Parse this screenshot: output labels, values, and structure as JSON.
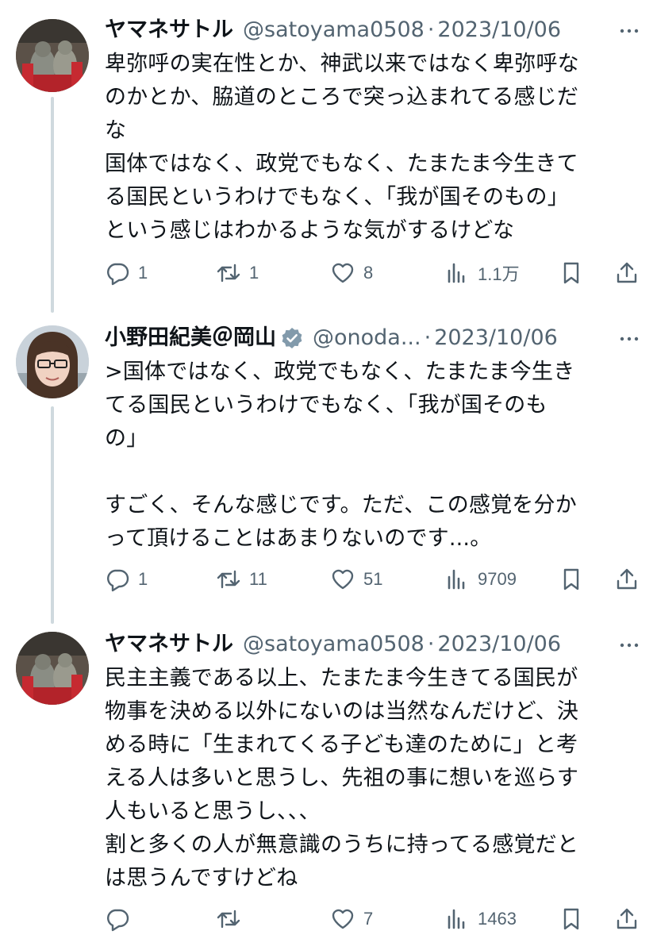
{
  "tweets": [
    {
      "author": "ヤマネサトル",
      "handle": "@satoyama0508",
      "separator": "·",
      "date": "2023/10/06",
      "body": "卑弥呼の実在性とか、神武以来ではなく卑弥呼な\nのかとか、脇道のところで突っ込まれてる感じだ\nな\n国体ではなく、政党でもなく、たまたま今生きて\nる国民というわけでもなく、「我が国そのもの」\nという感じはわかるような気がするけどな",
      "replies": "1",
      "retweets": "1",
      "likes": "8",
      "views": "1.1万"
    },
    {
      "author": "小野田紀美＠岡山",
      "handle": "@onoda...",
      "separator": "·",
      "date": "2023/10/06",
      "verified": true,
      "body": ">国体ではなく、政党でもなく、たまたま今生き\nてる国民というわけでもなく、「我が国そのも\nの」\n\nすごく、そんな感じです。ただ、この感覚を分か\nって頂けることはあまりないのです...。",
      "replies": "1",
      "retweets": "11",
      "likes": "51",
      "views": "9709"
    },
    {
      "author": "ヤマネサトル",
      "handle": "@satoyama0508",
      "separator": "·",
      "date": "2023/10/06",
      "body": "民主主義である以上、たまたま今生きてる国民が\n物事を決める以外にないのは当然なんだけど、決\nめる時に「生まれてくる子ども達のために」と考\nえる人は多いと思うし、先祖の事に想いを巡らす\n人もいると思うし、、、\n割と多くの人が無意識のうちに持ってる感覚だと\nは思うんですけどね",
      "replies": "",
      "retweets": "",
      "likes": "7",
      "views": "1463"
    }
  ],
  "icons": {
    "reply": "speech-bubble-icon",
    "retweet": "retweet-arrows-icon",
    "like": "heart-icon",
    "views": "bar-chart-icon",
    "bookmark": "bookmark-icon",
    "share": "share-upload-icon",
    "more": "more-dots-icon",
    "verified": "verified-badge-icon"
  },
  "colors": {
    "text": "#0f1419",
    "secondary": "#536471",
    "thread_line": "#cfd9de",
    "verified_badge": "#829aab"
  }
}
